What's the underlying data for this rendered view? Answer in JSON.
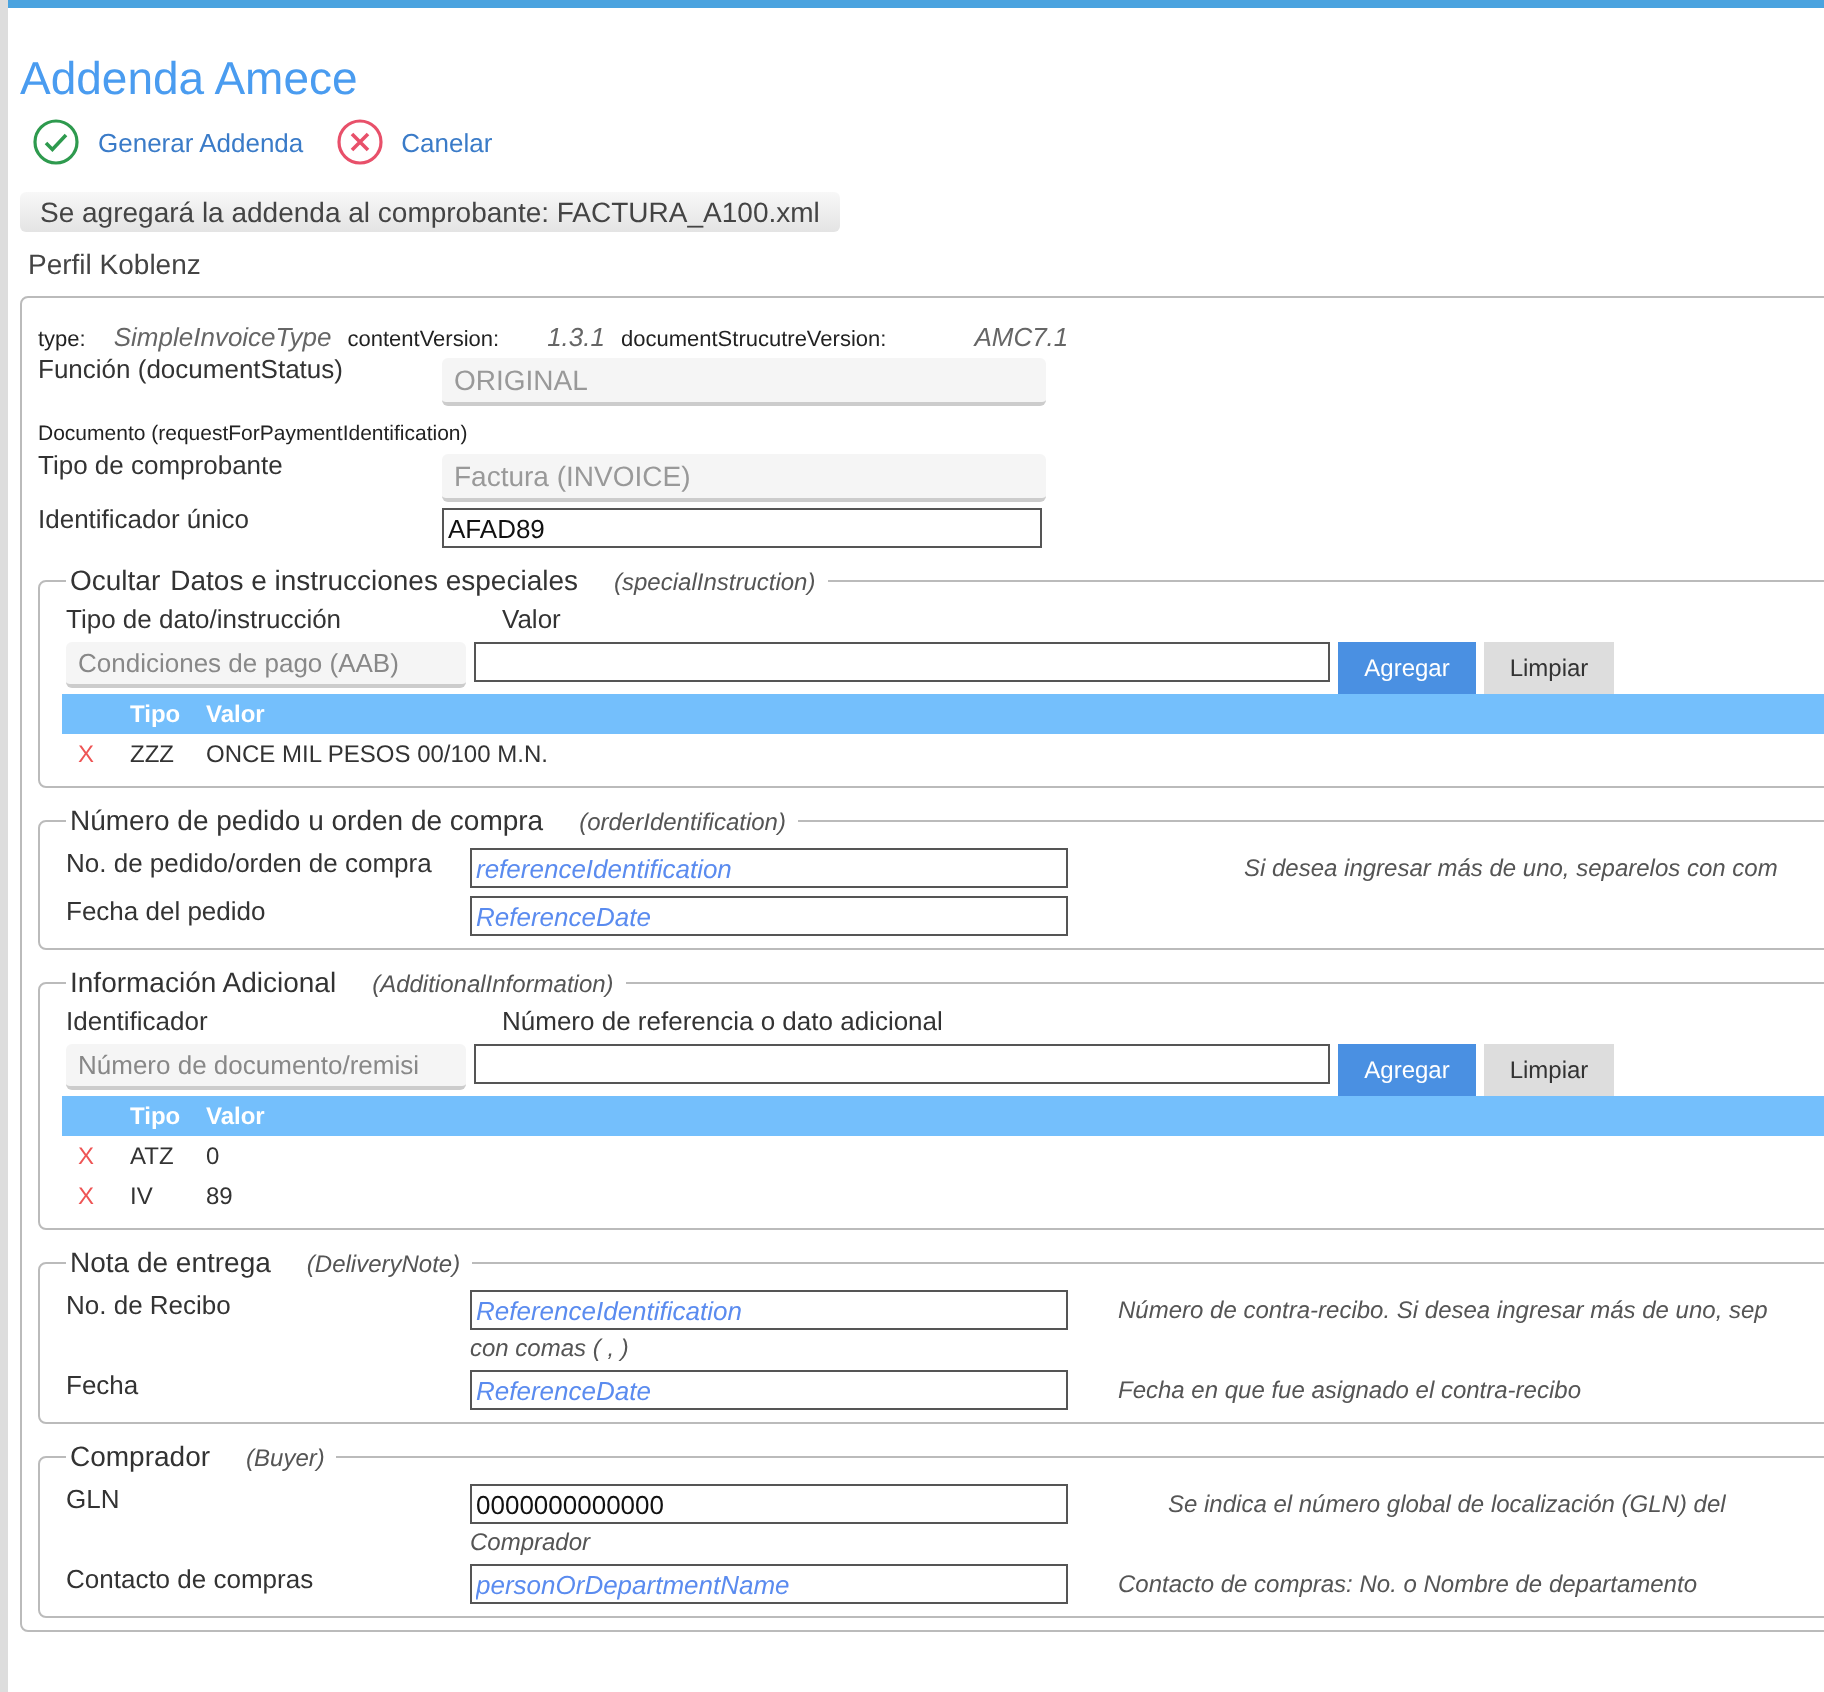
{
  "title": "Addenda Amece",
  "actions": [
    {
      "label": "Generar Addenda",
      "kind": "confirm"
    },
    {
      "label": "Canelar",
      "kind": "cancel"
    }
  ],
  "notice": "Se agregará la addenda al comprobante: FACTURA_A100.xml",
  "profile": "Perfil Koblenz",
  "meta": [
    {
      "label": "type:",
      "value": "SimpleInvoiceType"
    },
    {
      "label": "contentVersion:",
      "value": "1.3.1"
    },
    {
      "label": "documentStrucutreVersion:",
      "value": "AMC7.1"
    }
  ],
  "status_field": {
    "label": "Función (documentStatus)",
    "value": "ORIGINAL"
  },
  "document_label": "Documento (requestForPaymentIdentification)",
  "doc_type": {
    "label": "Tipo de comprobante",
    "value": "Factura (INVOICE)"
  },
  "unique_id": {
    "label": "Identificador único",
    "value": "AFAD89"
  },
  "sections": [
    {
      "kind": "list",
      "toggle": "Ocultar",
      "title": "Datos e instrucciones especiales",
      "tag": "(specialInstruction)",
      "col_label": "Tipo de dato/instrucción",
      "value_label": "Valor",
      "select_value": "Condiciones de pago (AAB)",
      "add": "Agregar",
      "clear": "Limpiar",
      "columns": [
        "Tipo",
        "Valor"
      ],
      "rows": [
        {
          "delete": "X",
          "type": "ZZZ",
          "value": "ONCE MIL PESOS 00/100 M.N."
        }
      ]
    },
    {
      "kind": "fields",
      "title": "Número de pedido u orden de compra",
      "tag": "(orderIdentification)",
      "hint_far": true,
      "rows": [
        {
          "label": "No. de pedido/orden de compra",
          "placeholder": "referenceIdentification",
          "hint": "Si desea ingresar más de uno, separelos con com"
        },
        {
          "label": "Fecha del pedido",
          "placeholder": "ReferenceDate"
        }
      ]
    },
    {
      "kind": "list",
      "title": "Información Adicional",
      "tag": "(AdditionalInformation)",
      "col_label": "Identificador",
      "value_label": "Número de referencia o dato adicional",
      "select_value": "Número de documento/remisi",
      "add": "Agregar",
      "clear": "Limpiar",
      "columns": [
        "Tipo",
        "Valor"
      ],
      "rows": [
        {
          "delete": "X",
          "type": "ATZ",
          "value": "0"
        },
        {
          "delete": "X",
          "type": "IV",
          "value": "89"
        }
      ]
    },
    {
      "kind": "fields",
      "title": "Nota de entrega",
      "tag": "(DeliveryNote)",
      "hint_far": false,
      "rows": [
        {
          "label": "No. de Recibo",
          "placeholder": "ReferenceIdentification",
          "hint": "Número de contra-recibo. Si desea ingresar más de uno, sep",
          "hint_continued": "con comas ( , )"
        },
        {
          "label": "Fecha",
          "placeholder": "ReferenceDate",
          "hint": "Fecha en que fue asignado el contra-recibo"
        }
      ]
    },
    {
      "kind": "fields",
      "title": "Comprador",
      "tag": "(Buyer)",
      "hint_far": false,
      "rows": [
        {
          "label": "GLN",
          "value": "0000000000000",
          "hint": "Se indica el número global de localización (GLN) del",
          "hint_continued": "Comprador",
          "hint_centered": true
        },
        {
          "label": "Contacto de compras",
          "placeholder": "personOrDepartmentName",
          "hint": "Contacto de compras: No. o Nombre de departamento"
        }
      ]
    }
  ]
}
